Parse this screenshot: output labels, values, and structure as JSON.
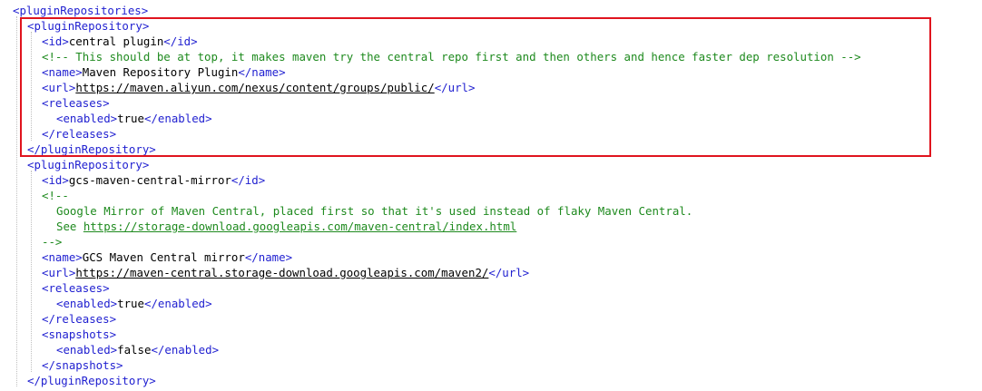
{
  "lines": [
    {
      "segments": [
        {
          "t": "tag",
          "v": "<pluginRepositories>"
        }
      ]
    },
    {
      "segments": [
        {
          "t": "tag",
          "v": "<pluginRepository>"
        }
      ]
    },
    {
      "segments": [
        {
          "t": "tag",
          "v": "<id>"
        },
        {
          "t": "txt",
          "v": "central plugin"
        },
        {
          "t": "tag",
          "v": "</id>"
        }
      ]
    },
    {
      "segments": [
        {
          "t": "cmt",
          "v": "<!-- This should be at top, it makes maven try the central repo first and then others and hence faster dep resolution -->"
        }
      ]
    },
    {
      "segments": [
        {
          "t": "tag",
          "v": "<name>"
        },
        {
          "t": "txt",
          "v": "Maven Repository Plugin"
        },
        {
          "t": "tag",
          "v": "</name>"
        }
      ]
    },
    {
      "segments": [
        {
          "t": "tag",
          "v": "<url>"
        },
        {
          "t": "url",
          "v": "https://maven.aliyun.com/nexus/content/groups/public/"
        },
        {
          "t": "tag",
          "v": "</url>"
        }
      ]
    },
    {
      "segments": [
        {
          "t": "tag",
          "v": "<releases>"
        }
      ]
    },
    {
      "segments": [
        {
          "t": "tag",
          "v": "<enabled>"
        },
        {
          "t": "txt",
          "v": "true"
        },
        {
          "t": "tag",
          "v": "</enabled>"
        }
      ]
    },
    {
      "segments": [
        {
          "t": "tag",
          "v": "</releases>"
        }
      ]
    },
    {
      "segments": [
        {
          "t": "tag",
          "v": "</pluginRepository>"
        }
      ]
    },
    {
      "segments": [
        {
          "t": "tag",
          "v": "<pluginRepository>"
        }
      ]
    },
    {
      "segments": [
        {
          "t": "tag",
          "v": "<id>"
        },
        {
          "t": "txt",
          "v": "gcs-maven-central-mirror"
        },
        {
          "t": "tag",
          "v": "</id>"
        }
      ]
    },
    {
      "segments": [
        {
          "t": "cmt",
          "v": "<!--"
        }
      ]
    },
    {
      "segments": [
        {
          "t": "cmt",
          "v": "Google Mirror of Maven Central, placed first so that it's used instead of flaky Maven Central."
        }
      ]
    },
    {
      "segments": [
        {
          "t": "cmt",
          "v": "See "
        },
        {
          "t": "curl",
          "v": "https://storage-download.googleapis.com/maven-central/index.html"
        }
      ]
    },
    {
      "segments": [
        {
          "t": "cmt",
          "v": "-->"
        }
      ]
    },
    {
      "segments": [
        {
          "t": "tag",
          "v": "<name>"
        },
        {
          "t": "txt",
          "v": "GCS Maven Central mirror"
        },
        {
          "t": "tag",
          "v": "</name>"
        }
      ]
    },
    {
      "segments": [
        {
          "t": "tag",
          "v": "<url>"
        },
        {
          "t": "url",
          "v": "https://maven-central.storage-download.googleapis.com/maven2/"
        },
        {
          "t": "tag",
          "v": "</url>"
        }
      ]
    },
    {
      "segments": [
        {
          "t": "tag",
          "v": "<releases>"
        }
      ]
    },
    {
      "segments": [
        {
          "t": "tag",
          "v": "<enabled>"
        },
        {
          "t": "txt",
          "v": "true"
        },
        {
          "t": "tag",
          "v": "</enabled>"
        }
      ]
    },
    {
      "segments": [
        {
          "t": "tag",
          "v": "</releases>"
        }
      ]
    },
    {
      "segments": [
        {
          "t": "tag",
          "v": "<snapshots>"
        }
      ]
    },
    {
      "segments": [
        {
          "t": "tag",
          "v": "<enabled>"
        },
        {
          "t": "txt",
          "v": "false"
        },
        {
          "t": "tag",
          "v": "</enabled>"
        }
      ]
    },
    {
      "segments": [
        {
          "t": "tag",
          "v": "</snapshots>"
        }
      ]
    },
    {
      "segments": [
        {
          "t": "tag",
          "v": "</pluginRepository>"
        }
      ]
    }
  ],
  "highlight_color": "#e0141e",
  "colors": {
    "tag": "#1f1fd0",
    "comment": "#1e8a1e",
    "text": "#000000"
  }
}
